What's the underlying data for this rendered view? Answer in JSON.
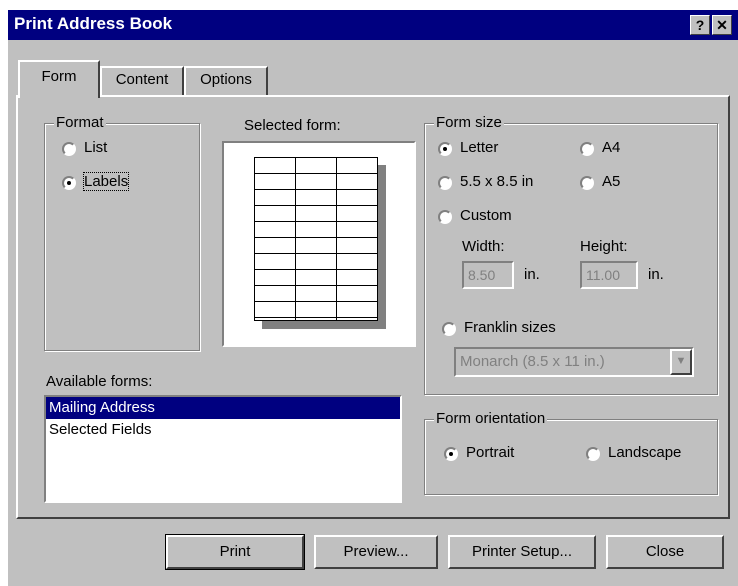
{
  "window": {
    "title": "Print Address Book",
    "help_glyph": "?",
    "close_glyph": "✕"
  },
  "tabs": [
    {
      "label": "Form",
      "active": true
    },
    {
      "label": "Content",
      "active": false
    },
    {
      "label": "Options",
      "active": false
    }
  ],
  "format": {
    "label": "Format",
    "list_label": "List",
    "labels_label": "Labels",
    "selected": "Labels"
  },
  "selected_form": {
    "label": "Selected form:"
  },
  "form_size": {
    "label": "Form size",
    "letter": "Letter",
    "a4": "A4",
    "half_letter": "5.5 x 8.5 in",
    "a5": "A5",
    "custom": "Custom",
    "width_label": "Width:",
    "height_label": "Height:",
    "width_value": "8.50",
    "height_value": "11.00",
    "unit": "in.",
    "franklin": "Franklin sizes",
    "franklin_value": "Monarch  (8.5 x 11 in.)",
    "selected": "Letter"
  },
  "available_forms": {
    "label": "Available forms:",
    "items": [
      "Mailing Address",
      "Selected Fields"
    ],
    "selected_index": 0
  },
  "orientation": {
    "label": "Form orientation",
    "portrait": "Portrait",
    "landscape": "Landscape",
    "selected": "Portrait"
  },
  "buttons": {
    "print": "Print",
    "preview": "Preview...",
    "printer_setup": "Printer Setup...",
    "close": "Close"
  },
  "colors": {
    "title_bar": "#000080",
    "face": "#c0c0c0",
    "selection": "#000080"
  }
}
